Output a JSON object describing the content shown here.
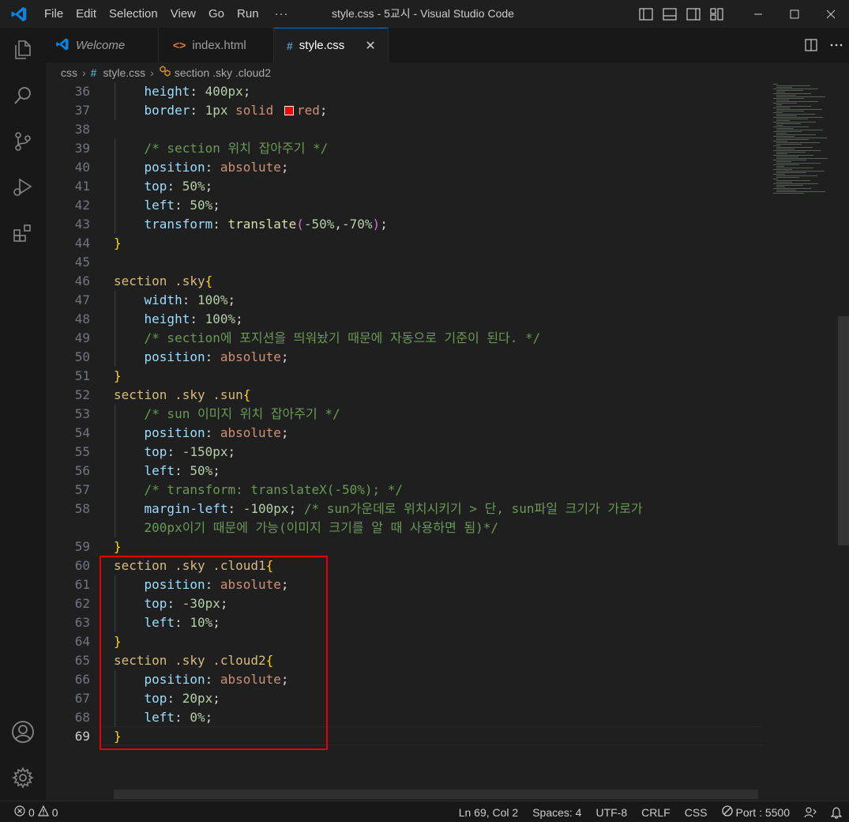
{
  "window": {
    "title": "style.css - 5교시 - Visual Studio Code",
    "menu": [
      "File",
      "Edit",
      "Selection",
      "View",
      "Go",
      "Run"
    ],
    "menu_more": "···"
  },
  "tabs": [
    {
      "label": "Welcome",
      "icon": "vscode-icon",
      "active": false
    },
    {
      "label": "index.html",
      "icon": "html-icon",
      "active": false
    },
    {
      "label": "style.css",
      "icon": "css-icon",
      "active": true
    }
  ],
  "tab_close": "✕",
  "breadcrumb": {
    "folder": "css",
    "file": "style.css",
    "symbol": "section .sky .cloud2",
    "hash": "#"
  },
  "editor": {
    "current_line": "69",
    "lines": [
      {
        "n": "36",
        "tokens": [
          [
            "ind",
            "    "
          ],
          [
            "prop",
            "height"
          ],
          [
            "punct",
            ": "
          ],
          [
            "num",
            "400px"
          ],
          [
            "punct",
            ";"
          ]
        ]
      },
      {
        "n": "37",
        "tokens": [
          [
            "ind",
            "    "
          ],
          [
            "prop",
            "border"
          ],
          [
            "punct",
            ": "
          ],
          [
            "num",
            "1px"
          ],
          [
            "punct",
            " "
          ],
          [
            "str",
            "solid "
          ],
          [
            "swatch",
            ""
          ],
          [
            "str",
            "red"
          ],
          [
            "punct",
            ";"
          ]
        ]
      },
      {
        "n": "38",
        "tokens": []
      },
      {
        "n": "39",
        "tokens": [
          [
            "ind",
            "    "
          ],
          [
            "cmt",
            "/* section 위치 잡아주기 */"
          ]
        ]
      },
      {
        "n": "40",
        "tokens": [
          [
            "ind",
            "    "
          ],
          [
            "prop",
            "position"
          ],
          [
            "punct",
            ": "
          ],
          [
            "str",
            "absolute"
          ],
          [
            "punct",
            ";"
          ]
        ]
      },
      {
        "n": "41",
        "tokens": [
          [
            "ind",
            "    "
          ],
          [
            "prop",
            "top"
          ],
          [
            "punct",
            ": "
          ],
          [
            "num",
            "50%"
          ],
          [
            "punct",
            ";"
          ]
        ]
      },
      {
        "n": "42",
        "tokens": [
          [
            "ind",
            "    "
          ],
          [
            "prop",
            "left"
          ],
          [
            "punct",
            ": "
          ],
          [
            "num",
            "50%"
          ],
          [
            "punct",
            ";"
          ]
        ]
      },
      {
        "n": "43",
        "tokens": [
          [
            "ind",
            "    "
          ],
          [
            "prop",
            "transform"
          ],
          [
            "punct",
            ": "
          ],
          [
            "fn",
            "translate"
          ],
          [
            "paren",
            "("
          ],
          [
            "num",
            "-50%"
          ],
          [
            "punct",
            ","
          ],
          [
            "num",
            "-70%"
          ],
          [
            "paren",
            ")"
          ],
          [
            "punct",
            ";"
          ]
        ]
      },
      {
        "n": "44",
        "tokens": [
          [
            "brace",
            "}"
          ]
        ]
      },
      {
        "n": "45",
        "tokens": []
      },
      {
        "n": "46",
        "tokens": [
          [
            "sel",
            "section .sky"
          ],
          [
            "brace",
            "{"
          ]
        ]
      },
      {
        "n": "47",
        "tokens": [
          [
            "ind",
            "    "
          ],
          [
            "prop",
            "width"
          ],
          [
            "punct",
            ": "
          ],
          [
            "num",
            "100%"
          ],
          [
            "punct",
            ";"
          ]
        ]
      },
      {
        "n": "48",
        "tokens": [
          [
            "ind",
            "    "
          ],
          [
            "prop",
            "height"
          ],
          [
            "punct",
            ": "
          ],
          [
            "num",
            "100%"
          ],
          [
            "punct",
            ";"
          ]
        ]
      },
      {
        "n": "49",
        "tokens": [
          [
            "ind",
            "    "
          ],
          [
            "cmt",
            "/* section에 포지션을 띄워놨기 때문에 자동으로 기준이 된다. */"
          ]
        ]
      },
      {
        "n": "50",
        "tokens": [
          [
            "ind",
            "    "
          ],
          [
            "prop",
            "position"
          ],
          [
            "punct",
            ": "
          ],
          [
            "str",
            "absolute"
          ],
          [
            "punct",
            ";"
          ]
        ]
      },
      {
        "n": "51",
        "tokens": [
          [
            "brace",
            "}"
          ]
        ]
      },
      {
        "n": "52",
        "tokens": [
          [
            "sel",
            "section .sky .sun"
          ],
          [
            "brace",
            "{"
          ]
        ]
      },
      {
        "n": "53",
        "tokens": [
          [
            "ind",
            "    "
          ],
          [
            "cmt",
            "/* sun 이미지 위치 잡아주기 */"
          ]
        ]
      },
      {
        "n": "54",
        "tokens": [
          [
            "ind",
            "    "
          ],
          [
            "prop",
            "position"
          ],
          [
            "punct",
            ": "
          ],
          [
            "str",
            "absolute"
          ],
          [
            "punct",
            ";"
          ]
        ]
      },
      {
        "n": "55",
        "tokens": [
          [
            "ind",
            "    "
          ],
          [
            "prop",
            "top"
          ],
          [
            "punct",
            ": "
          ],
          [
            "num",
            "-150px"
          ],
          [
            "punct",
            ";"
          ]
        ]
      },
      {
        "n": "56",
        "tokens": [
          [
            "ind",
            "    "
          ],
          [
            "prop",
            "left"
          ],
          [
            "punct",
            ": "
          ],
          [
            "num",
            "50%"
          ],
          [
            "punct",
            ";"
          ]
        ]
      },
      {
        "n": "57",
        "tokens": [
          [
            "ind",
            "    "
          ],
          [
            "cmt",
            "/* transform: translateX(-50%); */"
          ]
        ]
      },
      {
        "n": "58",
        "tokens": [
          [
            "ind",
            "    "
          ],
          [
            "prop",
            "margin-left"
          ],
          [
            "punct",
            ": "
          ],
          [
            "num",
            "-100px"
          ],
          [
            "punct",
            "; "
          ],
          [
            "cmt",
            "/* sun가운데로 위치시키기 > 단, sun파일 크기가 가로가"
          ]
        ]
      },
      {
        "n": "",
        "tokens": [
          [
            "ind",
            "    "
          ],
          [
            "cmt",
            "200px이기 때문에 가능(이미지 크기를 알 때 사용하면 됨)*/"
          ]
        ]
      },
      {
        "n": "59",
        "tokens": [
          [
            "brace",
            "}"
          ]
        ]
      },
      {
        "n": "60",
        "tokens": [
          [
            "sel",
            "section .sky .cloud1"
          ],
          [
            "brace",
            "{"
          ]
        ]
      },
      {
        "n": "61",
        "tokens": [
          [
            "ind",
            "    "
          ],
          [
            "prop",
            "position"
          ],
          [
            "punct",
            ": "
          ],
          [
            "str",
            "absolute"
          ],
          [
            "punct",
            ";"
          ]
        ]
      },
      {
        "n": "62",
        "tokens": [
          [
            "ind",
            "    "
          ],
          [
            "prop",
            "top"
          ],
          [
            "punct",
            ": "
          ],
          [
            "num",
            "-30px"
          ],
          [
            "punct",
            ";"
          ]
        ]
      },
      {
        "n": "63",
        "tokens": [
          [
            "ind",
            "    "
          ],
          [
            "prop",
            "left"
          ],
          [
            "punct",
            ": "
          ],
          [
            "num",
            "10%"
          ],
          [
            "punct",
            ";"
          ]
        ]
      },
      {
        "n": "64",
        "tokens": [
          [
            "brace",
            "}"
          ]
        ]
      },
      {
        "n": "65",
        "tokens": [
          [
            "sel",
            "section .sky .cloud2"
          ],
          [
            "brace",
            "{"
          ]
        ]
      },
      {
        "n": "66",
        "tokens": [
          [
            "ind",
            "    "
          ],
          [
            "prop",
            "position"
          ],
          [
            "punct",
            ": "
          ],
          [
            "str",
            "absolute"
          ],
          [
            "punct",
            ";"
          ]
        ]
      },
      {
        "n": "67",
        "tokens": [
          [
            "ind",
            "    "
          ],
          [
            "prop",
            "top"
          ],
          [
            "punct",
            ": "
          ],
          [
            "num",
            "20px"
          ],
          [
            "punct",
            ";"
          ]
        ]
      },
      {
        "n": "68",
        "tokens": [
          [
            "ind",
            "    "
          ],
          [
            "prop",
            "left"
          ],
          [
            "punct",
            ": "
          ],
          [
            "num",
            "0%"
          ],
          [
            "punct",
            ";"
          ]
        ]
      },
      {
        "n": "69",
        "tokens": [
          [
            "brace",
            "}"
          ]
        ]
      }
    ]
  },
  "statusbar": {
    "errors": "0",
    "warnings": "0",
    "position": "Ln 69, Col 2",
    "spaces": "Spaces: 4",
    "encoding": "UTF-8",
    "eol": "CRLF",
    "language": "CSS",
    "port": "Port : 5500"
  },
  "colors": {
    "accent": "#0078d4",
    "highlight_box": "#e60000",
    "selector": "#d7ba7d",
    "property": "#9cdcfe",
    "number": "#b5cea8",
    "string": "#ce9178",
    "comment": "#6a9955",
    "function": "#dcdcaa",
    "brace": "#ffd700"
  }
}
